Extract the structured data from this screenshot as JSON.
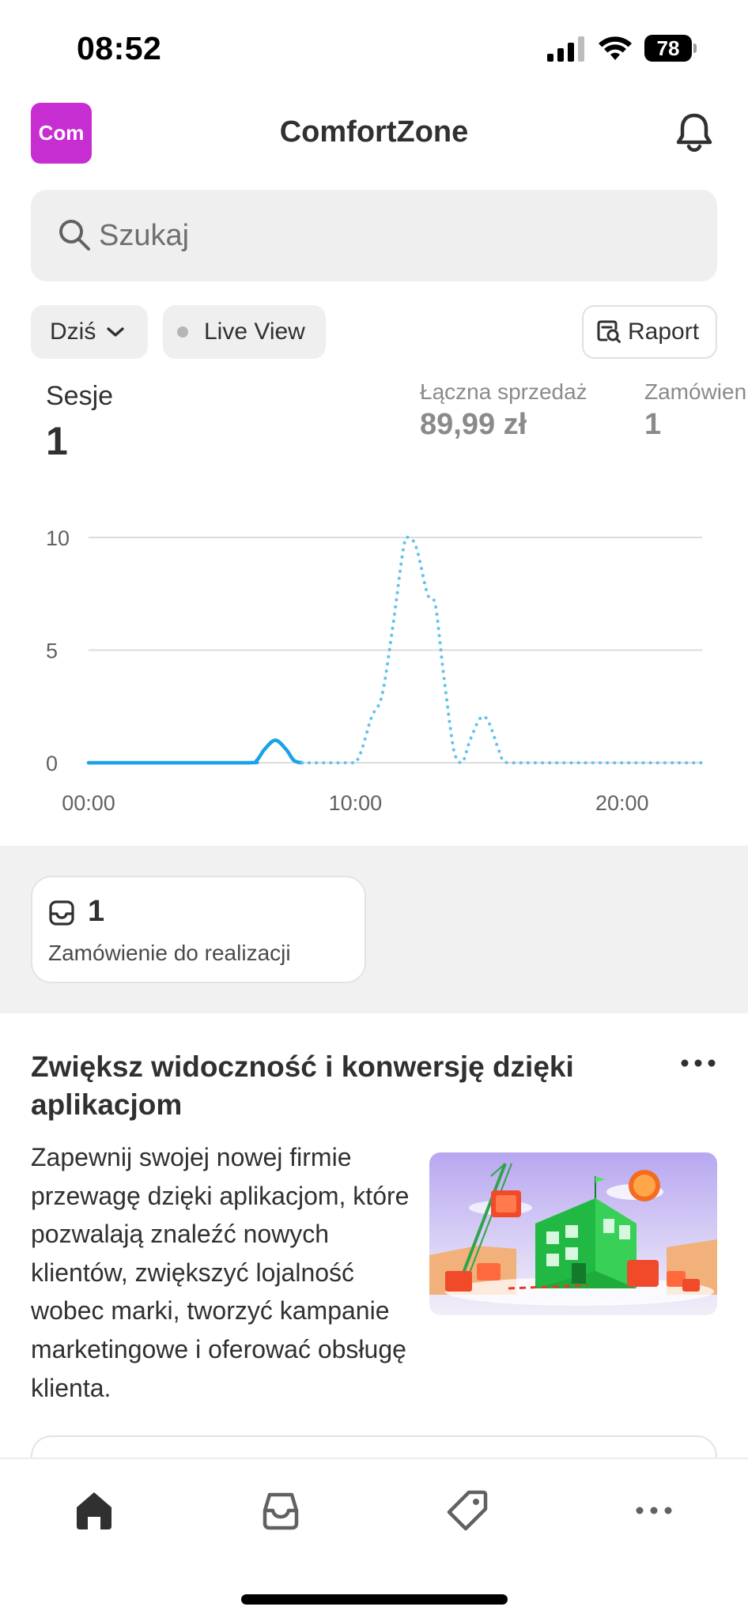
{
  "status_bar": {
    "time": "08:52",
    "battery": "78",
    "icons": [
      "signal-icon",
      "wifi-icon",
      "battery-icon"
    ]
  },
  "header": {
    "avatar_text": "Com",
    "avatar_color": "#c72ed2",
    "store_name": "ComfortZone",
    "icons": [
      "bell-icon"
    ]
  },
  "search": {
    "placeholder": "Szukaj",
    "value": ""
  },
  "filters": {
    "period": "Dziś",
    "live_view": "Live View",
    "report": "Raport"
  },
  "metrics": [
    {
      "label": "Sesje",
      "value": "1"
    },
    {
      "label": "Łączna sprzedaż",
      "value": "89,99 zł"
    },
    {
      "label": "Zamówienia",
      "value": "1"
    }
  ],
  "chart_data": {
    "type": "line",
    "title": "",
    "xlabel": "",
    "ylabel": "",
    "x_ticks": [
      "00:00",
      "10:00",
      "20:00"
    ],
    "y_ticks": [
      "0",
      "5",
      "10"
    ],
    "xlim": [
      0,
      23
    ],
    "ylim": [
      0,
      10
    ],
    "grid": true,
    "series": [
      {
        "style": "solid",
        "color": "#1aa2e8",
        "points": [
          [
            0,
            0
          ],
          [
            3,
            0
          ],
          [
            6,
            0
          ],
          [
            6.3,
            0.1
          ],
          [
            6.6,
            0.6
          ],
          [
            7,
            1
          ],
          [
            7.4,
            0.6
          ],
          [
            7.7,
            0.1
          ],
          [
            8,
            0
          ]
        ]
      },
      {
        "style": "dotted",
        "color": "#62c2ee",
        "points": [
          [
            8,
            0
          ],
          [
            9,
            0
          ],
          [
            10,
            0
          ],
          [
            10.6,
            2
          ],
          [
            11,
            3
          ],
          [
            11.4,
            6
          ],
          [
            11.8,
            9.5
          ],
          [
            12,
            10
          ],
          [
            12.3,
            9.5
          ],
          [
            12.7,
            7.5
          ],
          [
            13,
            7
          ],
          [
            13.3,
            4
          ],
          [
            13.7,
            0.5
          ],
          [
            14,
            0
          ],
          [
            14.3,
            1
          ],
          [
            14.7,
            2
          ],
          [
            15,
            1.8
          ],
          [
            15.4,
            0.5
          ],
          [
            15.7,
            0
          ],
          [
            17,
            0
          ],
          [
            20,
            0
          ],
          [
            23,
            0
          ]
        ]
      }
    ]
  },
  "orders_card": {
    "count": "1",
    "label": "Zamówienie do realizacji",
    "icon": "inbox-icon"
  },
  "promo": {
    "title": "Zwiększ widoczność i konwersję dzięki aplikacjom",
    "body": "Zapewnij swojej nowej firmie przewagę dzięki aplikacjom, które pozwalają znaleźć nowych klientów, zwiększyć lojalność wobec marki, tworzyć kampanie marketingowe i oferować obsługę klienta.",
    "icons": [
      "more-options-icon"
    ]
  },
  "tab_bar": {
    "tabs": [
      "home-icon",
      "orders-icon",
      "products-icon",
      "more-icon"
    ],
    "active": "home-icon"
  }
}
